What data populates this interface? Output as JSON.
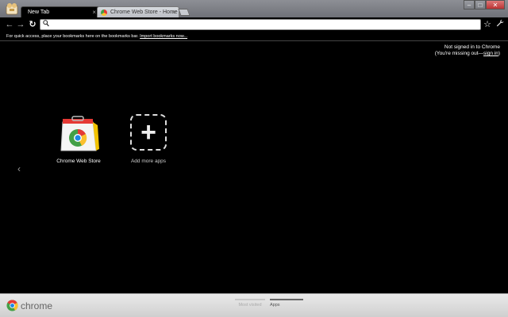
{
  "tabs": [
    {
      "title": "New Tab",
      "close": "×"
    },
    {
      "title": "Chrome Web Store - Home",
      "close": "×"
    }
  ],
  "window_controls": {
    "minimize": "–",
    "maximize": "□",
    "close": "✕"
  },
  "toolbar": {
    "back": "←",
    "forward": "→",
    "reload": "↻",
    "omnibox_value": "",
    "star": "☆",
    "wrench": "🔧"
  },
  "bookmarks": {
    "prompt": "For quick access, place your bookmarks here on the bookmarks bar.",
    "import_link": "Import bookmarks now..."
  },
  "signin": {
    "line1": "Not signed in to Chrome",
    "line2_prefix": "(You're missing out—",
    "link": "sign in",
    "line2_suffix": ")"
  },
  "apps": [
    {
      "label": "Chrome Web Store",
      "icon": "web-store-icon"
    },
    {
      "label": "Add more apps",
      "icon": "plus-icon"
    }
  ],
  "pager_prev": "‹",
  "footer": {
    "brand": "chrome",
    "sections": [
      {
        "label": "Most visited",
        "selected": false
      },
      {
        "label": "Apps",
        "selected": true
      }
    ]
  }
}
